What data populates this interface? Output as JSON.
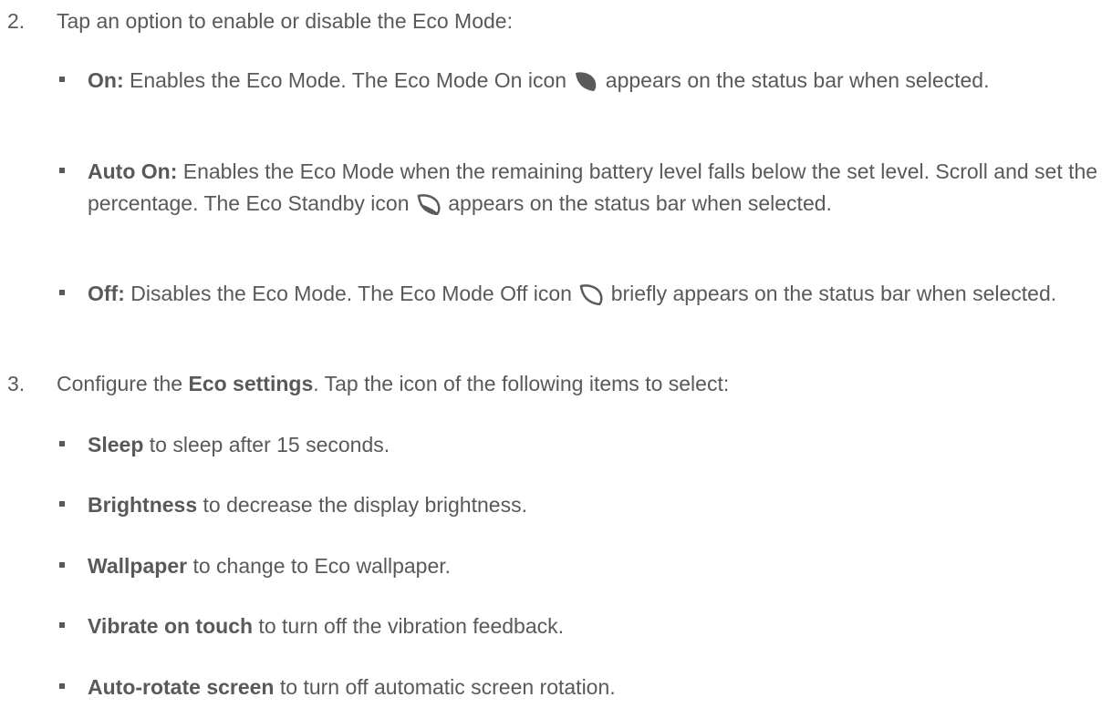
{
  "step2": {
    "number": "2.",
    "text": "Tap an option to enable or disable the Eco Mode:",
    "options": [
      {
        "label": "On:",
        "before_icon": " Enables the Eco Mode. The Eco Mode On icon ",
        "icon": "eco-mode-on-leaf-icon",
        "after_icon": " appears on the status bar when selected."
      },
      {
        "label": "Auto On:",
        "before_icon": " Enables the Eco Mode when the remaining battery level falls below the set level. Scroll and set the percentage. The Eco Standby icon ",
        "icon": "eco-standby-leaf-icon",
        "after_icon": " appears on the status bar when selected."
      },
      {
        "label": "Off:",
        "before_icon": " Disables the Eco Mode. The Eco Mode Off icon ",
        "icon": "eco-mode-off-leaf-icon",
        "after_icon": " briefly appears on the status bar when selected."
      }
    ]
  },
  "step3": {
    "number": "3.",
    "pre": "Configure the ",
    "bold": "Eco settings",
    "post": ". Tap the icon of the following items to select:",
    "items": [
      {
        "bold": "Sleep",
        "text": " to sleep after 15 seconds."
      },
      {
        "bold": "Brightness",
        "text": " to decrease the display brightness."
      },
      {
        "bold": "Wallpaper",
        "text": " to change to Eco wallpaper."
      },
      {
        "bold": "Vibrate on touch",
        "text": " to turn off the vibration feedback."
      },
      {
        "bold": "Auto-rotate screen",
        "text": " to turn off automatic screen rotation."
      }
    ]
  }
}
